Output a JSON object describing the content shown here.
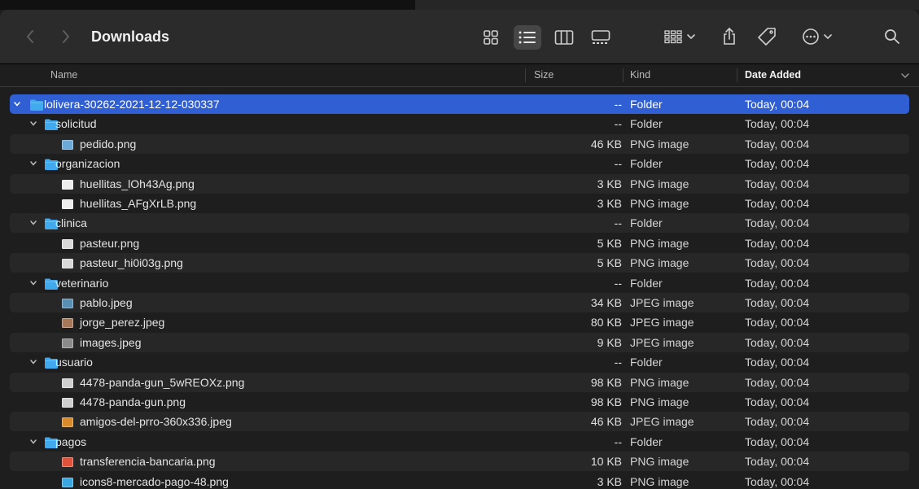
{
  "window": {
    "title": "Downloads"
  },
  "columns": {
    "name": "Name",
    "size": "Size",
    "kind": "Kind",
    "date_added": "Date Added"
  },
  "colors": {
    "accent": "#2f5fd3",
    "folder": "#41a9ee"
  },
  "files": [
    {
      "name": "lolivera-30262-2021-12-12-030337",
      "size": "--",
      "kind": "Folder",
      "date": "Today, 00:04",
      "depth": 0,
      "type": "folder",
      "icon": "folder-icon",
      "selected": true
    },
    {
      "name": "solicitud",
      "size": "--",
      "kind": "Folder",
      "date": "Today, 00:04",
      "depth": 1,
      "type": "folder",
      "icon": "folder-icon"
    },
    {
      "name": "pedido.png",
      "size": "46 KB",
      "kind": "PNG image",
      "date": "Today, 00:04",
      "depth": 2,
      "type": "file",
      "icon": "image-thumbnail-icon",
      "tint": "#6aa9d8"
    },
    {
      "name": "organizacion",
      "size": "--",
      "kind": "Folder",
      "date": "Today, 00:04",
      "depth": 1,
      "type": "folder",
      "icon": "folder-icon"
    },
    {
      "name": "huellitas_lOh43Ag.png",
      "size": "3 KB",
      "kind": "PNG image",
      "date": "Today, 00:04",
      "depth": 2,
      "type": "file",
      "icon": "image-thumbnail-icon",
      "tint": "#eeeeee"
    },
    {
      "name": "huellitas_AFgXrLB.png",
      "size": "3 KB",
      "kind": "PNG image",
      "date": "Today, 00:04",
      "depth": 2,
      "type": "file",
      "icon": "image-thumbnail-icon",
      "tint": "#eeeeee"
    },
    {
      "name": "clinica",
      "size": "--",
      "kind": "Folder",
      "date": "Today, 00:04",
      "depth": 1,
      "type": "folder",
      "icon": "folder-icon"
    },
    {
      "name": "pasteur.png",
      "size": "5 KB",
      "kind": "PNG image",
      "date": "Today, 00:04",
      "depth": 2,
      "type": "file",
      "icon": "image-thumbnail-icon",
      "tint": "#d9d9d9"
    },
    {
      "name": "pasteur_hi0i03g.png",
      "size": "5 KB",
      "kind": "PNG image",
      "date": "Today, 00:04",
      "depth": 2,
      "type": "file",
      "icon": "image-thumbnail-icon",
      "tint": "#d9d9d9"
    },
    {
      "name": "veterinario",
      "size": "--",
      "kind": "Folder",
      "date": "Today, 00:04",
      "depth": 1,
      "type": "folder",
      "icon": "folder-icon"
    },
    {
      "name": "pablo.jpeg",
      "size": "34 KB",
      "kind": "JPEG image",
      "date": "Today, 00:04",
      "depth": 2,
      "type": "file",
      "icon": "image-thumbnail-icon",
      "tint": "#5a8fb5"
    },
    {
      "name": "jorge_perez.jpeg",
      "size": "80 KB",
      "kind": "JPEG image",
      "date": "Today, 00:04",
      "depth": 2,
      "type": "file",
      "icon": "image-thumbnail-icon",
      "tint": "#a8785a"
    },
    {
      "name": "images.jpeg",
      "size": "9 KB",
      "kind": "JPEG image",
      "date": "Today, 00:04",
      "depth": 2,
      "type": "file",
      "icon": "image-thumbnail-icon",
      "tint": "#8a8a8a"
    },
    {
      "name": "usuario",
      "size": "--",
      "kind": "Folder",
      "date": "Today, 00:04",
      "depth": 1,
      "type": "folder",
      "icon": "folder-icon"
    },
    {
      "name": "4478-panda-gun_5wREOXz.png",
      "size": "98 KB",
      "kind": "PNG image",
      "date": "Today, 00:04",
      "depth": 2,
      "type": "file",
      "icon": "image-thumbnail-icon",
      "tint": "#cfcfcf"
    },
    {
      "name": "4478-panda-gun.png",
      "size": "98 KB",
      "kind": "PNG image",
      "date": "Today, 00:04",
      "depth": 2,
      "type": "file",
      "icon": "image-thumbnail-icon",
      "tint": "#cfcfcf"
    },
    {
      "name": "amigos-del-prro-360x336.jpeg",
      "size": "46 KB",
      "kind": "JPEG image",
      "date": "Today, 00:04",
      "depth": 2,
      "type": "file",
      "icon": "image-thumbnail-icon",
      "tint": "#d98a2a"
    },
    {
      "name": "pagos",
      "size": "--",
      "kind": "Folder",
      "date": "Today, 00:04",
      "depth": 1,
      "type": "folder",
      "icon": "folder-icon"
    },
    {
      "name": "transferencia-bancaria.png",
      "size": "10 KB",
      "kind": "PNG image",
      "date": "Today, 00:04",
      "depth": 2,
      "type": "file",
      "icon": "image-thumbnail-icon",
      "tint": "#e0533a"
    },
    {
      "name": "icons8-mercado-pago-48.png",
      "size": "3 KB",
      "kind": "PNG image",
      "date": "Today, 00:04",
      "depth": 2,
      "type": "file",
      "icon": "image-thumbnail-icon",
      "tint": "#3aa7e0"
    }
  ]
}
